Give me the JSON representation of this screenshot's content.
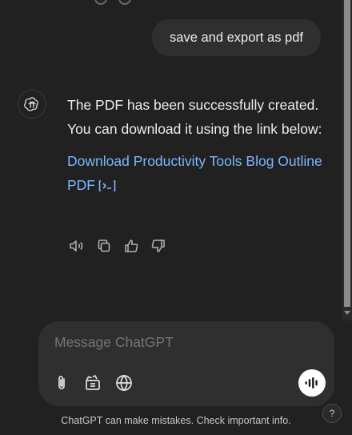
{
  "conversation": {
    "user_message": "save and export as pdf",
    "assistant": {
      "paragraph": "The PDF has been successfully created. You can download it using the link below:",
      "link_text": "Download Productivity Tools Blog Outline PDF"
    },
    "action_icons": [
      "read-aloud-icon",
      "copy-icon",
      "thumbs-up-icon",
      "thumbs-down-icon"
    ]
  },
  "composer": {
    "placeholder": "Message ChatGPT",
    "tools": [
      "paperclip-icon",
      "tools-icon",
      "globe-icon"
    ],
    "voice_icon": "voice-wave-icon"
  },
  "footer": {
    "disclaimer": "ChatGPT can make mistakes. Check important info.",
    "help_label": "?"
  },
  "colors": {
    "background": "#212121",
    "bubble": "#2f2f2f",
    "link": "#7ab7ff",
    "text": "#ececec"
  }
}
